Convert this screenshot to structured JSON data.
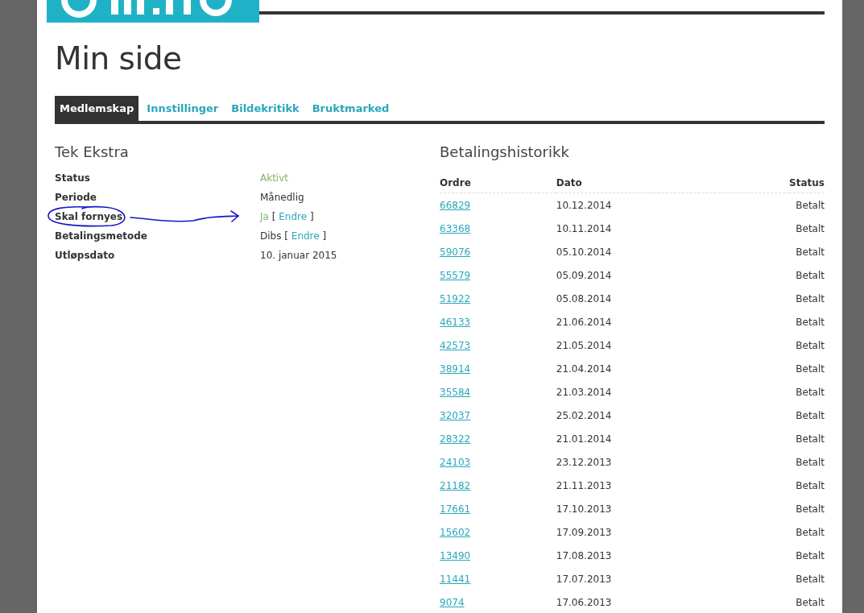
{
  "page": {
    "title": "Min side"
  },
  "tabs": [
    {
      "label": "Medlemskap",
      "selected": true
    },
    {
      "label": "Innstillinger",
      "selected": false
    },
    {
      "label": "Bildekritikk",
      "selected": false
    },
    {
      "label": "Bruktmarked",
      "selected": false
    }
  ],
  "membership": {
    "title": "Tek Ekstra",
    "rows": [
      {
        "label": "Status",
        "value": "Aktivt",
        "kind": "status"
      },
      {
        "label": "Periode",
        "value": "Månedlig",
        "kind": "plain"
      },
      {
        "label": "Skal fornyes",
        "value": "Ja",
        "kind": "status",
        "link_open": "[",
        "link": "Endre",
        "link_close": "]",
        "annotated": true
      },
      {
        "label": "Betalingsmetode",
        "value": "Dibs",
        "kind": "plain",
        "link_open": "[",
        "link": "Endre",
        "link_close": "]"
      },
      {
        "label": "Utløpsdato",
        "value": "10. januar 2015",
        "kind": "plain"
      }
    ]
  },
  "payments": {
    "title": "Betalingshistorikk",
    "columns": [
      "Ordre",
      "Dato",
      "Status"
    ],
    "rows": [
      [
        "66829",
        "10.12.2014",
        "Betalt"
      ],
      [
        "63368",
        "10.11.2014",
        "Betalt"
      ],
      [
        "59076",
        "05.10.2014",
        "Betalt"
      ],
      [
        "55579",
        "05.09.2014",
        "Betalt"
      ],
      [
        "51922",
        "05.08.2014",
        "Betalt"
      ],
      [
        "46133",
        "21.06.2014",
        "Betalt"
      ],
      [
        "42573",
        "21.05.2014",
        "Betalt"
      ],
      [
        "38914",
        "21.04.2014",
        "Betalt"
      ],
      [
        "35584",
        "21.03.2014",
        "Betalt"
      ],
      [
        "32037",
        "25.02.2014",
        "Betalt"
      ],
      [
        "28322",
        "21.01.2014",
        "Betalt"
      ],
      [
        "24103",
        "23.12.2013",
        "Betalt"
      ],
      [
        "21182",
        "21.11.2013",
        "Betalt"
      ],
      [
        "17661",
        "17.10.2013",
        "Betalt"
      ],
      [
        "15602",
        "17.09.2013",
        "Betalt"
      ],
      [
        "13490",
        "17.08.2013",
        "Betalt"
      ],
      [
        "11441",
        "17.07.2013",
        "Betalt"
      ],
      [
        "9074",
        "17.06.2013",
        "Betalt"
      ]
    ]
  }
}
